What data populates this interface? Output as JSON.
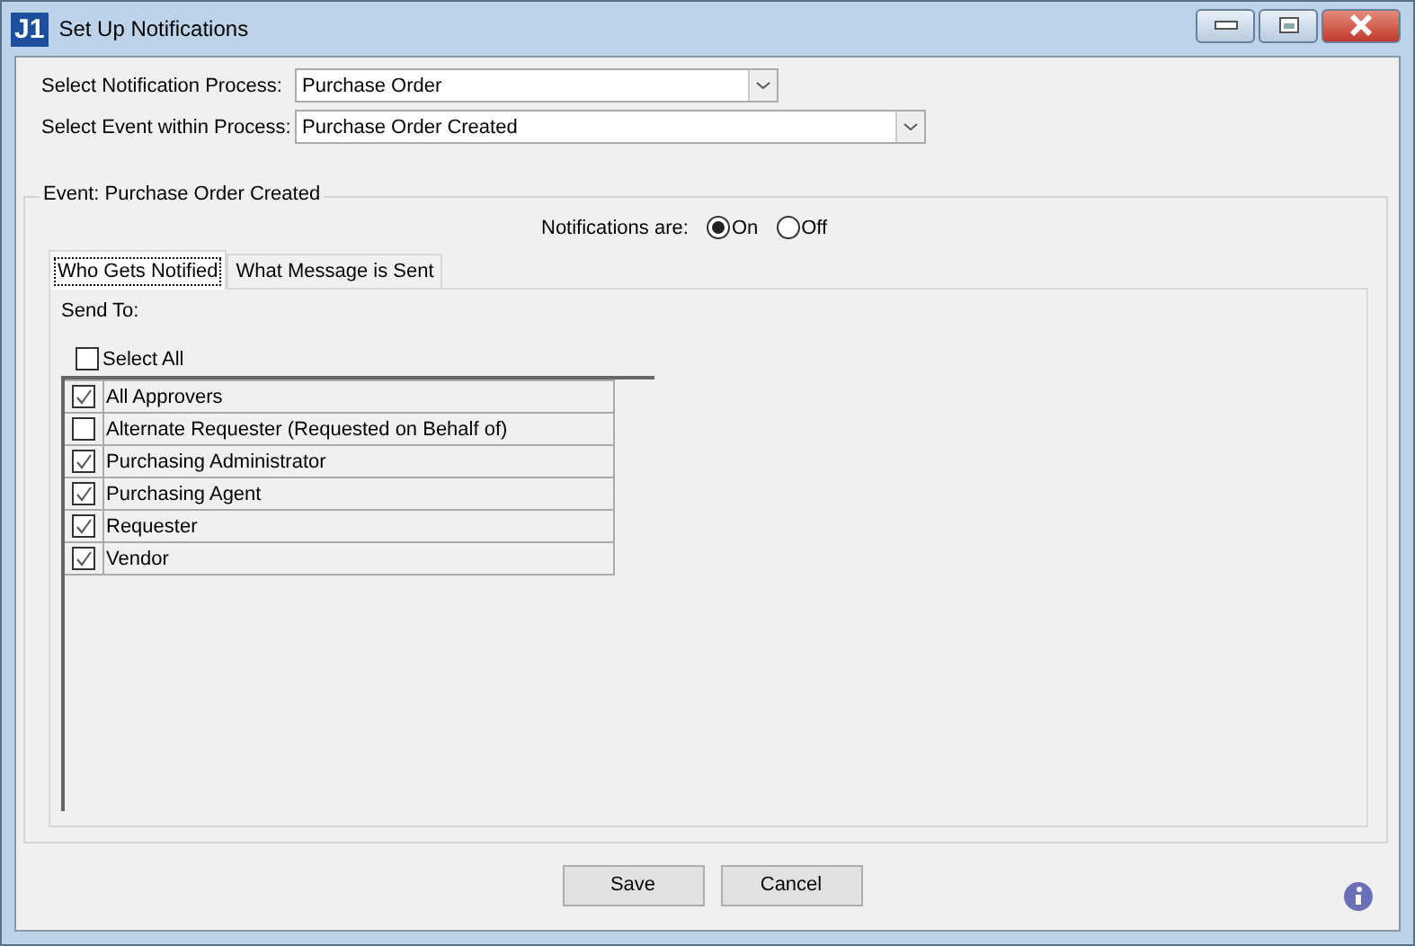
{
  "window": {
    "logo": "J1",
    "title": "Set Up Notifications"
  },
  "process": {
    "label": "Select Notification Process:",
    "value": "Purchase Order"
  },
  "event": {
    "label": "Select Event within Process:",
    "value": "Purchase Order Created"
  },
  "group": {
    "legend": "Event: Purchase Order Created",
    "notifications": {
      "label": "Notifications are:",
      "options": [
        {
          "label": "On",
          "selected": true
        },
        {
          "label": "Off",
          "selected": false
        }
      ]
    },
    "tabs": [
      {
        "label": "Who Gets Notified",
        "selected": true
      },
      {
        "label": "What Message is Sent",
        "selected": false
      }
    ],
    "send_to": "Send To:",
    "select_all": {
      "label": "Select All",
      "checked": false
    },
    "recipients": [
      {
        "name": "All Approvers",
        "checked": true
      },
      {
        "name": "Alternate Requester (Requested on Behalf of)",
        "checked": false
      },
      {
        "name": "Purchasing Administrator",
        "checked": true
      },
      {
        "name": "Purchasing Agent",
        "checked": true
      },
      {
        "name": "Requester",
        "checked": true
      },
      {
        "name": "Vendor",
        "checked": true
      }
    ]
  },
  "buttons": [
    "Save",
    "Cancel"
  ]
}
